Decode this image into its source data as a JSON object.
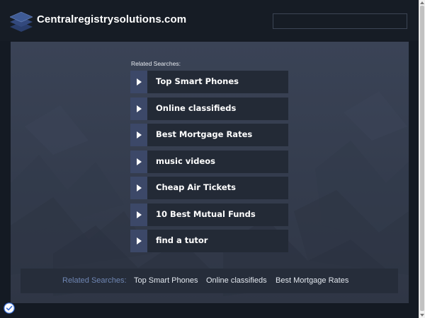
{
  "header": {
    "site_name": "Centralregistrysolutions.com",
    "logo_icon": "stacked-layers-icon",
    "search_value": ""
  },
  "main": {
    "related_title": "Related Searches:",
    "links": [
      {
        "label": "Top Smart Phones"
      },
      {
        "label": "Online classifieds"
      },
      {
        "label": "Best Mortgage Rates"
      },
      {
        "label": "music videos"
      },
      {
        "label": "Cheap Air Tickets"
      },
      {
        "label": "10 Best Mutual Funds"
      },
      {
        "label": "find a tutor"
      }
    ]
  },
  "bottom_bar": {
    "label": "Related Searches:",
    "links": [
      {
        "label": "Top Smart Phones"
      },
      {
        "label": "Online classifieds"
      },
      {
        "label": "Best Mortgage Rates"
      }
    ]
  },
  "colors": {
    "page_bg": "#141a23",
    "panel_bg": "#363e50",
    "link_bg": "#232a36",
    "arrow_bg": "#3c4868",
    "bottom_label": "#6f86b3",
    "logo_blue": "#3f5b95"
  },
  "icons": {
    "arrow": "play-arrow-icon",
    "privacy": "privacy-check-icon"
  }
}
